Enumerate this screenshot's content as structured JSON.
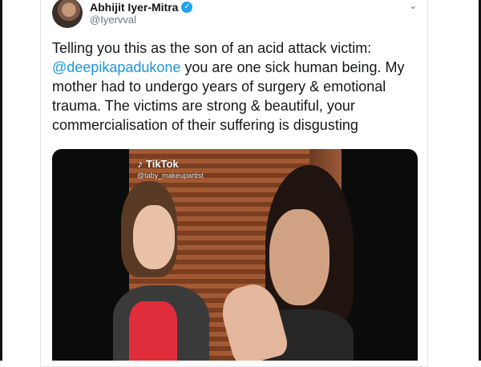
{
  "tweet": {
    "author_name": "Abhijit Iyer-Mitra",
    "author_handle": "@Iyervval",
    "verified_icon": "verified-badge-icon",
    "caret_icon": "chevron-down-icon",
    "text_part1": "Telling you this as the son of an acid attack victim:",
    "mention": "@deepikapadukone",
    "text_part2": " you are one sick human being. My mother had to undergo years of surgery & emotional trauma. The victims are strong & beautiful, your commercialisation of their suffering is disgusting"
  },
  "media": {
    "brand_label": "TikTok",
    "brand_icon": "tiktok-note-icon",
    "username": "@taby_makeupartist"
  },
  "colors": {
    "link": "#1b95e0",
    "verified": "#1da1f2",
    "text": "#14171a",
    "muted": "#657786"
  }
}
